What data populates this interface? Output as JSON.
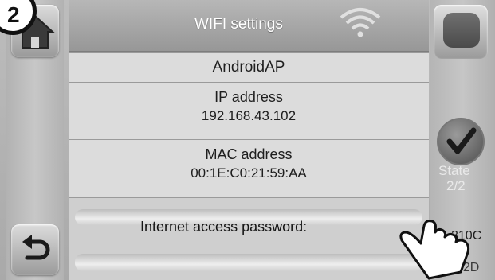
{
  "step_badge": "2",
  "header": {
    "title": "WIFI settings",
    "wifi_icon": "wifi-signal-icon"
  },
  "network": {
    "ssid": "AndroidAP"
  },
  "ip": {
    "label": "IP address",
    "value": "192.168.43.102"
  },
  "mac": {
    "label": "MAC address",
    "value": "00:1E:C0:21:59:AA"
  },
  "password": {
    "label": "Internet access password:"
  },
  "sidebar_left": {
    "home_icon": "home-icon",
    "back_icon": "back-arrow-icon"
  },
  "sidebar_right": {
    "check_icon": "checkmark-icon",
    "state_label": "State",
    "state_value": "2/2",
    "code1": "310C",
    "code2": "D2.2D"
  },
  "overlay": {
    "hand_icon": "pointing-hand-icon"
  }
}
